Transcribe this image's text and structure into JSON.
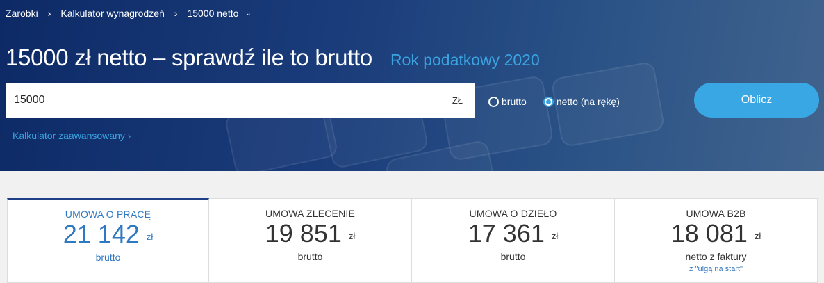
{
  "breadcrumb": {
    "items": [
      "Zarobki",
      "Kalkulator wynagrodzeń",
      "15000 netto"
    ]
  },
  "header": {
    "title": "15000 zł netto – sprawdź ile to brutto",
    "tax_year": "Rok podatkowy 2020"
  },
  "form": {
    "amount_value": "15000",
    "currency": "ZŁ",
    "radio_options": [
      {
        "label": "brutto",
        "checked": false
      },
      {
        "label": "netto (na rękę)",
        "checked": true
      }
    ],
    "submit_label": "Oblicz",
    "advanced_link": "Kalkulator zaawansowany ›"
  },
  "results": [
    {
      "label": "UMOWA O PRACĘ",
      "amount": "21 142",
      "unit": "zł",
      "sub": "brutto",
      "note": ""
    },
    {
      "label": "UMOWA ZLECENIE",
      "amount": "19 851",
      "unit": "zł",
      "sub": "brutto",
      "note": ""
    },
    {
      "label": "UMOWA O DZIEŁO",
      "amount": "17 361",
      "unit": "zł",
      "sub": "brutto",
      "note": ""
    },
    {
      "label": "UMOWA B2B",
      "amount": "18 081",
      "unit": "zł",
      "sub": "netto z faktury",
      "note": "z \"ulgą na start\""
    }
  ],
  "colors": {
    "accent": "#39a7e3",
    "active_tab": "#2f78c2",
    "hero_dark": "#0d2a66"
  }
}
